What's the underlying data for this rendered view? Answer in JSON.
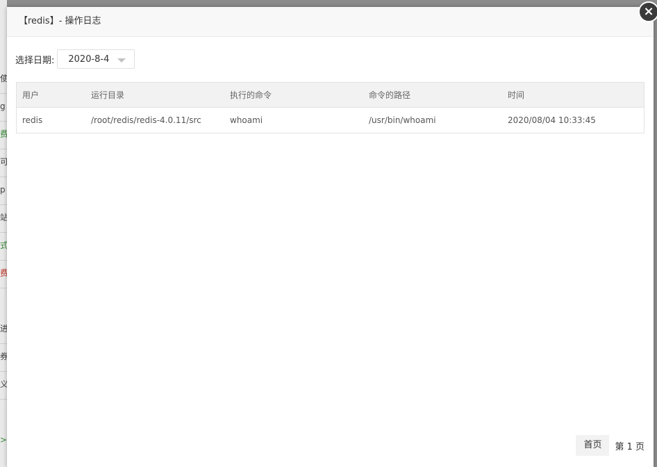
{
  "background": {
    "fragments": [
      "使",
      "g",
      "费",
      "可",
      "p",
      "站",
      "式",
      "费",
      "进",
      "券",
      "义",
      ">"
    ]
  },
  "dialog": {
    "title": "【redis】- 操作日志",
    "close_symbol": "×"
  },
  "filter": {
    "label": "选择日期:",
    "selected_date": "2020-8-4"
  },
  "table": {
    "headers": [
      "用户",
      "运行目录",
      "执行的命令",
      "命令的路径",
      "时间"
    ],
    "rows": [
      [
        "redis",
        "/root/redis/redis-4.0.11/src",
        "whoami",
        "/usr/bin/whoami",
        "2020/08/04 10:33:45"
      ]
    ]
  },
  "pagination": {
    "first_label": "首页",
    "page_info": "第 1 页"
  }
}
